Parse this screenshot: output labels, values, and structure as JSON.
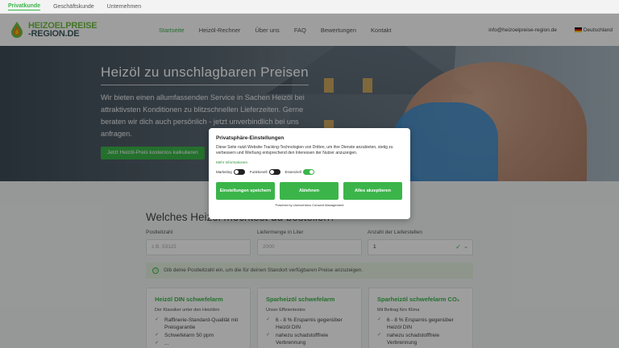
{
  "segments": [
    "Privatkunde",
    "Geschäftskunde",
    "Unternehmen"
  ],
  "logo": {
    "line1": "HEIZOELPREISE",
    "line2": "-REGION.DE"
  },
  "nav": [
    "Startseite",
    "Heizöl-Rechner",
    "Über uns",
    "FAQ",
    "Bewertungen",
    "Kontakt"
  ],
  "header": {
    "email": "info@heizoelpreise-region.de",
    "country": "Deutschland"
  },
  "hero": {
    "title": "Heizöl zu unschlagbaren Preisen",
    "text": "Wir bieten einen allumfassenden Service in Sachen Heizöl bei attraktivsten Konditionen zu blitzschnellen Lieferzeiten. Gerne beraten wir dich auch persönlich - jetzt unverbindlich bei uns anfragen.",
    "cta": "Jetzt Heizöl-Preis kostenlos kalkulieren"
  },
  "calc": {
    "title": "Welches Heizöl möchtest du bestellen?",
    "fields": [
      {
        "label": "Postleitzahl",
        "placeholder": "z.B. 53115"
      },
      {
        "label": "Liefermenge in Liter",
        "placeholder": "2000"
      },
      {
        "label": "Anzahl der Lieferstellen",
        "value": "1"
      }
    ],
    "info": "Gib deine Postleitzahl ein, um die für deinen Standort verfügbaren Preise anzuzeigen."
  },
  "cards": [
    {
      "title": "Heizöl DIN schwefelarm",
      "sub": "Der Klassiker unter den Heizölen",
      "items": [
        "Raffinerie-Standard-Qualität mit Preisgarantie",
        "Schwefelarm 50 ppm",
        "..."
      ]
    },
    {
      "title": "Sparheizöl schwefelarm",
      "sub": "Unser Effizientestes",
      "items": [
        "6 - 8 % Ersparnis gegenüber Heizöl DIN",
        "nahezu schadstofffreie Verbrennung"
      ]
    },
    {
      "title": "Sparheizöl schwefelarm CO₂",
      "sub": "Mit Beitrag fürs Klima",
      "items": [
        "6 - 8 % Ersparnis gegenüber Heizöl DIN",
        "nahezu schadstofffreie Verbrennung"
      ]
    }
  ],
  "consent": {
    "title": "Privatsphäre-Einstellungen",
    "desc": "Diese Seite nutzt Website-Tracking-Technologien von Dritten, um ihre Dienste anzubieten, stetig zu verbessern und Werbung entsprechend den Interessen der Nutzer anzuzeigen.",
    "more": "Mehr Informationen",
    "toggles": [
      {
        "label": "Marketing",
        "on": false
      },
      {
        "label": "Funktionell",
        "on": false
      },
      {
        "label": "Essenziell",
        "on": true
      }
    ],
    "buttons": [
      "Einstellungen speichern",
      "Ablehnen",
      "Alles akzeptieren"
    ],
    "powered": "Powered by Usercentrics Consent Management"
  },
  "colors": {
    "accent": "#3bb54a",
    "text": "#333333"
  }
}
